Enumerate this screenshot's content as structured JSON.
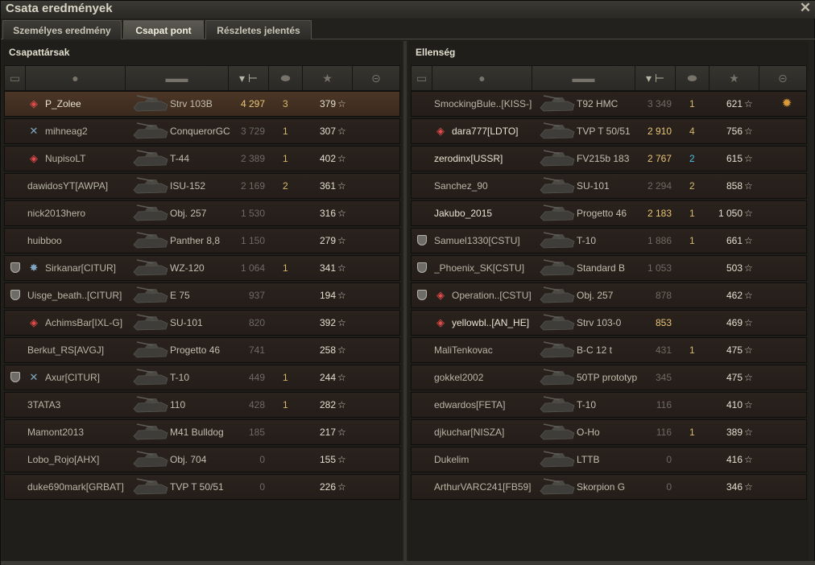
{
  "window": {
    "title": "Csata eredmények"
  },
  "tabs": [
    {
      "label": "Személyes eredmény"
    },
    {
      "label": "Csapat pont"
    },
    {
      "label": "Részletes jelentés"
    }
  ],
  "active_tab": 1,
  "left": {
    "title": "Csapattársak",
    "rows": [
      {
        "name": "P_Zolee",
        "vehicle": "Strv 103B",
        "damage": "4 297",
        "kills": "3",
        "xp": "379",
        "badge": "diamond",
        "clan_icon": false,
        "me": true,
        "name_bright": true,
        "dmg_hi": true
      },
      {
        "name": "mihneag2",
        "vehicle": "ConquerorGC",
        "damage": "3 729",
        "kills": "1",
        "xp": "307",
        "badge": "cross",
        "clan_icon": false
      },
      {
        "name": "NupisoLT",
        "vehicle": "T-44",
        "damage": "2 389",
        "kills": "1",
        "xp": "402",
        "badge": "diamond",
        "clan_icon": false
      },
      {
        "name": "dawidosYT[AWPA]",
        "vehicle": "ISU-152",
        "damage": "2 169",
        "kills": "2",
        "xp": "361"
      },
      {
        "name": "nick2013hero",
        "vehicle": "Obj. 257",
        "damage": "1 530",
        "kills": "",
        "xp": "316"
      },
      {
        "name": "huibboo",
        "vehicle": "Panther 8,8",
        "damage": "1 150",
        "kills": "",
        "xp": "279"
      },
      {
        "name": "Sirkanar[CITUR]",
        "vehicle": "WZ-120",
        "damage": "1 064",
        "kills": "1",
        "xp": "341",
        "badge": "star-badge",
        "clan_icon": true
      },
      {
        "name": "Uisge_beath..[CITUR]",
        "vehicle": "E 75",
        "damage": "937",
        "kills": "",
        "xp": "194",
        "clan_icon": true
      },
      {
        "name": "AchimsBar[IXL-G]",
        "vehicle": "SU-101",
        "damage": "820",
        "kills": "",
        "xp": "392",
        "badge": "diamond"
      },
      {
        "name": "Berkut_RS[AVGJ]",
        "vehicle": "Progetto 46",
        "damage": "741",
        "kills": "",
        "xp": "258"
      },
      {
        "name": "Axur[CITUR]",
        "vehicle": "T-10",
        "damage": "449",
        "kills": "1",
        "xp": "244",
        "badge": "cross",
        "clan_icon": true
      },
      {
        "name": "3TATA3",
        "vehicle": "110",
        "damage": "428",
        "kills": "1",
        "xp": "282"
      },
      {
        "name": "Mamont2013",
        "vehicle": "M41 Bulldog",
        "damage": "185",
        "kills": "",
        "xp": "217"
      },
      {
        "name": "Lobo_Rojo[AHX]",
        "vehicle": "Obj. 704",
        "damage": "0",
        "kills": "",
        "xp": "155"
      },
      {
        "name": "duke690mark[GRBAT]",
        "vehicle": "TVP T 50/51",
        "damage": "0",
        "kills": "",
        "xp": "226"
      }
    ]
  },
  "right": {
    "title": "Ellenség",
    "rows": [
      {
        "name": "SmockingBule..[KISS-]",
        "vehicle": "T92 HMC",
        "damage": "3 349",
        "kills": "1",
        "xp": "621",
        "medal": true
      },
      {
        "name": "dara777[LDTO]",
        "vehicle": "TVP T 50/51",
        "damage": "2 910",
        "kills": "4",
        "xp": "756",
        "badge": "diamond",
        "name_bright": true,
        "dmg_hi": true
      },
      {
        "name": "zerodinx[USSR]",
        "vehicle": "FV215b 183",
        "damage": "2 767",
        "kills": "2",
        "xp": "615",
        "name_bright": true,
        "dmg_hi": true,
        "kills_cyan": true
      },
      {
        "name": "Sanchez_90",
        "vehicle": "SU-101",
        "damage": "2 294",
        "kills": "2",
        "xp": "858"
      },
      {
        "name": "Jakubo_2015",
        "vehicle": "Progetto 46",
        "damage": "2 183",
        "kills": "1",
        "xp": "1 050",
        "name_bright": true,
        "dmg_hi": true
      },
      {
        "name": "Samuel1330[CSTU]",
        "vehicle": "T-10",
        "damage": "1 886",
        "kills": "1",
        "xp": "661",
        "clan_icon": true
      },
      {
        "name": "_Phoenix_SK[CSTU]",
        "vehicle": "Standard B",
        "damage": "1 053",
        "kills": "",
        "xp": "503",
        "clan_icon": true
      },
      {
        "name": "Operation..[CSTU]",
        "vehicle": "Obj. 257",
        "damage": "878",
        "kills": "",
        "xp": "462",
        "badge": "diamond",
        "clan_icon": true
      },
      {
        "name": "yellowbl..[AN_HE]",
        "vehicle": "Strv 103-0",
        "damage": "853",
        "kills": "",
        "xp": "469",
        "badge": "diamond",
        "name_bright": true,
        "dmg_hi": true
      },
      {
        "name": "MaliTenkovac",
        "vehicle": "B-C 12 t",
        "damage": "431",
        "kills": "1",
        "xp": "475"
      },
      {
        "name": "gokkel2002",
        "vehicle": "50TP prototyp",
        "damage": "345",
        "kills": "",
        "xp": "475"
      },
      {
        "name": "edwardos[FETA]",
        "vehicle": "T-10",
        "damage": "116",
        "kills": "",
        "xp": "410"
      },
      {
        "name": "djkuchar[NISZA]",
        "vehicle": "O-Ho",
        "damage": "116",
        "kills": "1",
        "xp": "389"
      },
      {
        "name": "Dukelim",
        "vehicle": "LTTB",
        "damage": "0",
        "kills": "",
        "xp": "416"
      },
      {
        "name": "ArthurVARC241[FB59]",
        "vehicle": "Skorpion G",
        "damage": "0",
        "kills": "",
        "xp": "346"
      }
    ]
  },
  "header_icons": [
    "clan-icon",
    "player-icon",
    "tank-icon",
    "damage-icon",
    "kills-icon",
    "xp-star-icon",
    "medal-icon"
  ],
  "colors": {
    "accent_damage": "#e9c678",
    "kills": "#d8b96b",
    "kills_cyan": "#4cc2ea",
    "badge_red": "#e44c4c",
    "row_me": "#4c3626"
  }
}
